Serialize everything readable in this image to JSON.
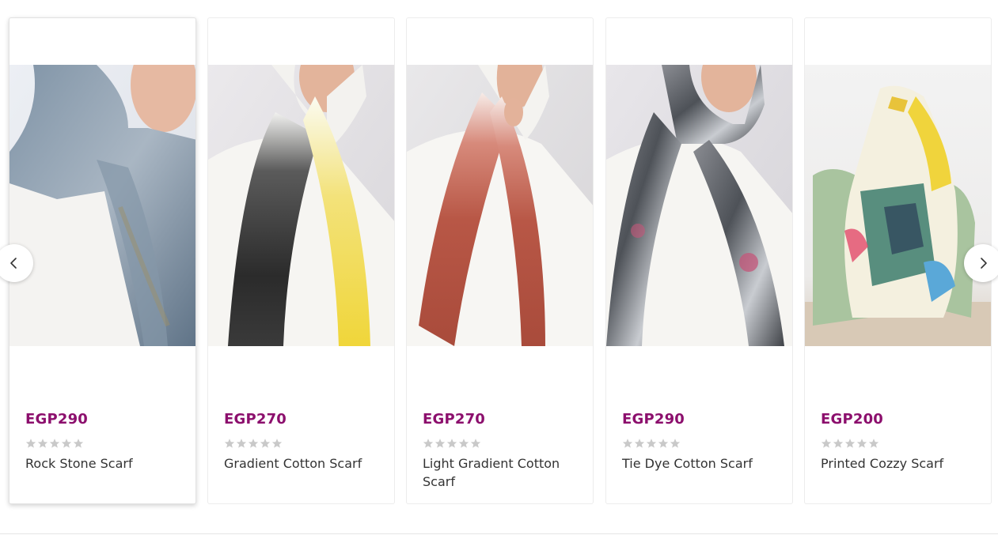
{
  "carousel": {
    "prev_icon": "chevron-left-icon",
    "next_icon": "chevron-right-icon",
    "star_color": "#c9c9c9",
    "price_color": "#8c0f6d",
    "products": [
      {
        "price": "EGP290",
        "name": "Rock Stone Scarf",
        "rating": 0
      },
      {
        "price": "EGP270",
        "name": "Gradient Cotton Scarf",
        "rating": 0
      },
      {
        "price": "EGP270",
        "name": "Light Gradient Cotton Scarf",
        "rating": 0
      },
      {
        "price": "EGP290",
        "name": "Tie Dye Cotton Scarf",
        "rating": 0
      },
      {
        "price": "EGP200",
        "name": "Printed Cozzy Scarf",
        "rating": 0
      }
    ]
  }
}
